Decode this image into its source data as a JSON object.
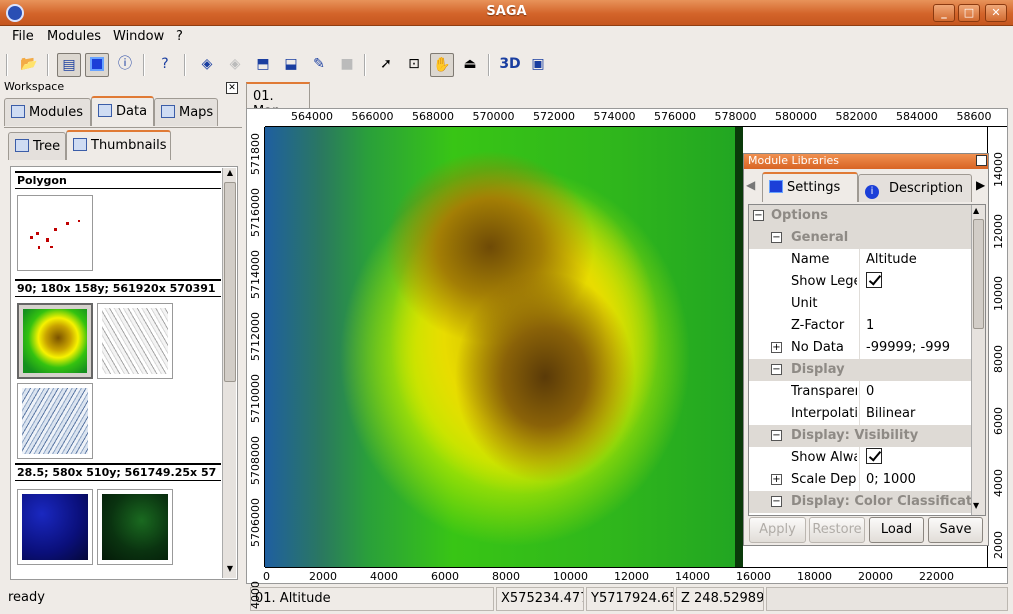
{
  "window": {
    "title": "SAGA"
  },
  "menu": [
    "File",
    "Modules",
    "Window",
    "?"
  ],
  "workspace": {
    "title": "Workspace",
    "tabs": [
      "Modules",
      "Data",
      "Maps"
    ],
    "subtabs": [
      "Tree",
      "Thumbnails"
    ],
    "groups": [
      "Polygon",
      "90; 180x 158y; 561920x 570391",
      "28.5; 580x 510y; 561749.25x 57"
    ]
  },
  "map": {
    "tab_label": "01. Map",
    "top_ticks": [
      "564000",
      "566000",
      "568000",
      "570000",
      "572000",
      "574000",
      "576000",
      "578000",
      "580000",
      "582000",
      "584000",
      "58600"
    ],
    "bottom_ticks": [
      "0",
      "2000",
      "4000",
      "6000",
      "8000",
      "10000",
      "12000",
      "14000",
      "16000",
      "18000",
      "20000",
      "22000"
    ],
    "left_ticks": [
      "571800",
      "5716000",
      "5714000",
      "5712000",
      "5710000",
      "5708000",
      "5706000",
      "4000"
    ],
    "right_ticks": [
      "14000",
      "12000",
      "10000",
      "8000",
      "6000",
      "4000",
      "2000"
    ]
  },
  "module_libraries": {
    "title": "Module Libraries",
    "tabs": [
      "Settings",
      "Description"
    ],
    "rows": {
      "options": "Options",
      "general": "General",
      "name_key": "Name",
      "name_val": "Altitude",
      "legend_key": "Show Lege",
      "unit_key": "Unit",
      "unit_val": "",
      "zfactor_key": "Z-Factor",
      "zfactor_val": "1",
      "nodata_key": "No Data",
      "nodata_val": "-99999; -999",
      "display": "Display",
      "transp_key": "Transparer",
      "transp_val": "0",
      "interp_key": "Interpolatic",
      "interp_val": "Bilinear",
      "vis": "Display: Visibility",
      "always_key": "Show Alwa",
      "scale_key": "Scale Depe",
      "scale_val": "0; 1000",
      "color": "Display: Color Classificat"
    },
    "buttons": {
      "apply": "Apply",
      "restore": "Restore",
      "load": "Load",
      "save": "Save"
    }
  },
  "status": {
    "ready": "ready",
    "layer": "01. Altitude",
    "x": "X575234.477",
    "y": "Y5717924.65",
    "z": "Z 248.52989"
  }
}
